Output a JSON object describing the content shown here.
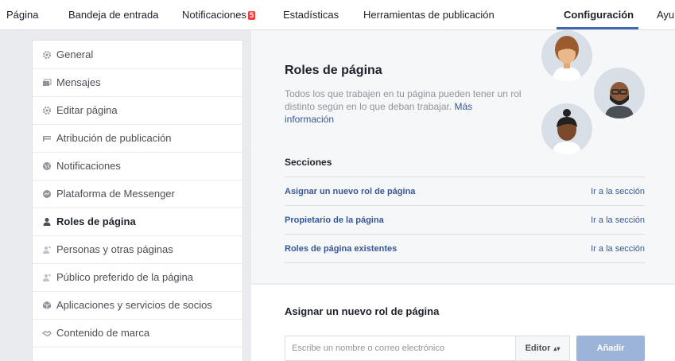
{
  "topnav": {
    "items": [
      {
        "label": "Página"
      },
      {
        "label": "Bandeja de entrada"
      },
      {
        "label": "Notificaciones",
        "badge": "5"
      },
      {
        "label": "Estadísticas"
      },
      {
        "label": "Herramientas de publicación"
      },
      {
        "label": "Configuración",
        "active": true
      },
      {
        "label": "Ayu"
      }
    ]
  },
  "sidebar": {
    "items": [
      {
        "label": "General",
        "icon": "gear-icon"
      },
      {
        "label": "Mensajes",
        "icon": "messages-icon"
      },
      {
        "label": "Editar página",
        "icon": "gear-icon"
      },
      {
        "label": "Atribución de publicación",
        "icon": "flag-icon"
      },
      {
        "label": "Notificaciones",
        "icon": "globe-icon"
      },
      {
        "label": "Plataforma de Messenger",
        "icon": "messenger-icon"
      },
      {
        "label": "Roles de página",
        "icon": "person-icon",
        "active": true
      },
      {
        "label": "Personas y otras páginas",
        "icon": "people-icon"
      },
      {
        "label": "Público preferido de la página",
        "icon": "people-icon"
      },
      {
        "label": "Aplicaciones y servicios de socios",
        "icon": "cube-icon"
      },
      {
        "label": "Contenido de marca",
        "icon": "handshake-icon"
      }
    ]
  },
  "main": {
    "title": "Roles de página",
    "description": "Todos los que trabajen en tu página pueden tener un rol distinto según en lo que deban trabajar.",
    "description_link": "Más información",
    "sections_title": "Secciones",
    "sections": [
      {
        "label": "Asignar un nuevo rol de página",
        "link": "Ir a la sección"
      },
      {
        "label": "Propietario de la página",
        "link": "Ir a la sección"
      },
      {
        "label": "Roles de página existentes",
        "link": "Ir a la sección"
      }
    ],
    "assign": {
      "title": "Asignar un nuevo rol de página",
      "input_placeholder": "Escribe un nombre o correo electrónico",
      "input_value": "",
      "role_selected": "Editor",
      "add_button": "Añadir"
    }
  },
  "colors": {
    "accent": "#4267b2",
    "link": "#365899",
    "badge": "#fa3e3e",
    "button_disabled": "#9cb4d8"
  }
}
